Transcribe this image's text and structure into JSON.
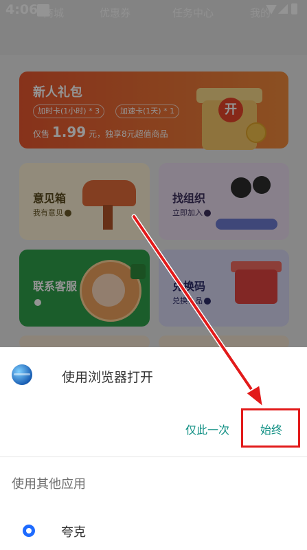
{
  "status_bar": {
    "time": "4:06"
  },
  "tabs": [
    "商城",
    "优惠券",
    "任务中心",
    "我的"
  ],
  "banner": {
    "title": "新人礼包",
    "chips": [
      "加时卡(1小时) * 3",
      "加速卡(1天) * 1"
    ],
    "price_prefix": "仅售",
    "price_value": "1.99",
    "price_suffix": "元，独享8元超值商品",
    "gift_text": "开"
  },
  "cards": [
    {
      "title": "意见箱",
      "subtitle": "我有意见"
    },
    {
      "title": "找组织",
      "subtitle": "立即加入"
    },
    {
      "title": "联系客服",
      "subtitle": ""
    },
    {
      "title": "兑换码",
      "subtitle": "兑换礼品"
    }
  ],
  "sheet": {
    "title": "使用浏览器打开",
    "once_label": "仅此一次",
    "always_label": "始终",
    "other_apps_label": "使用其他应用",
    "app_name": "夸克"
  },
  "colors": {
    "accent": "#0f8f83",
    "highlight": "#e21a1a",
    "banner_start": "#e8572f",
    "banner_end": "#f08a3b"
  },
  "icons": [
    "notification-icon",
    "wifi-icon",
    "signal-icon",
    "battery-icon",
    "globe-icon",
    "quark-icon",
    "arrow-annotation"
  ]
}
